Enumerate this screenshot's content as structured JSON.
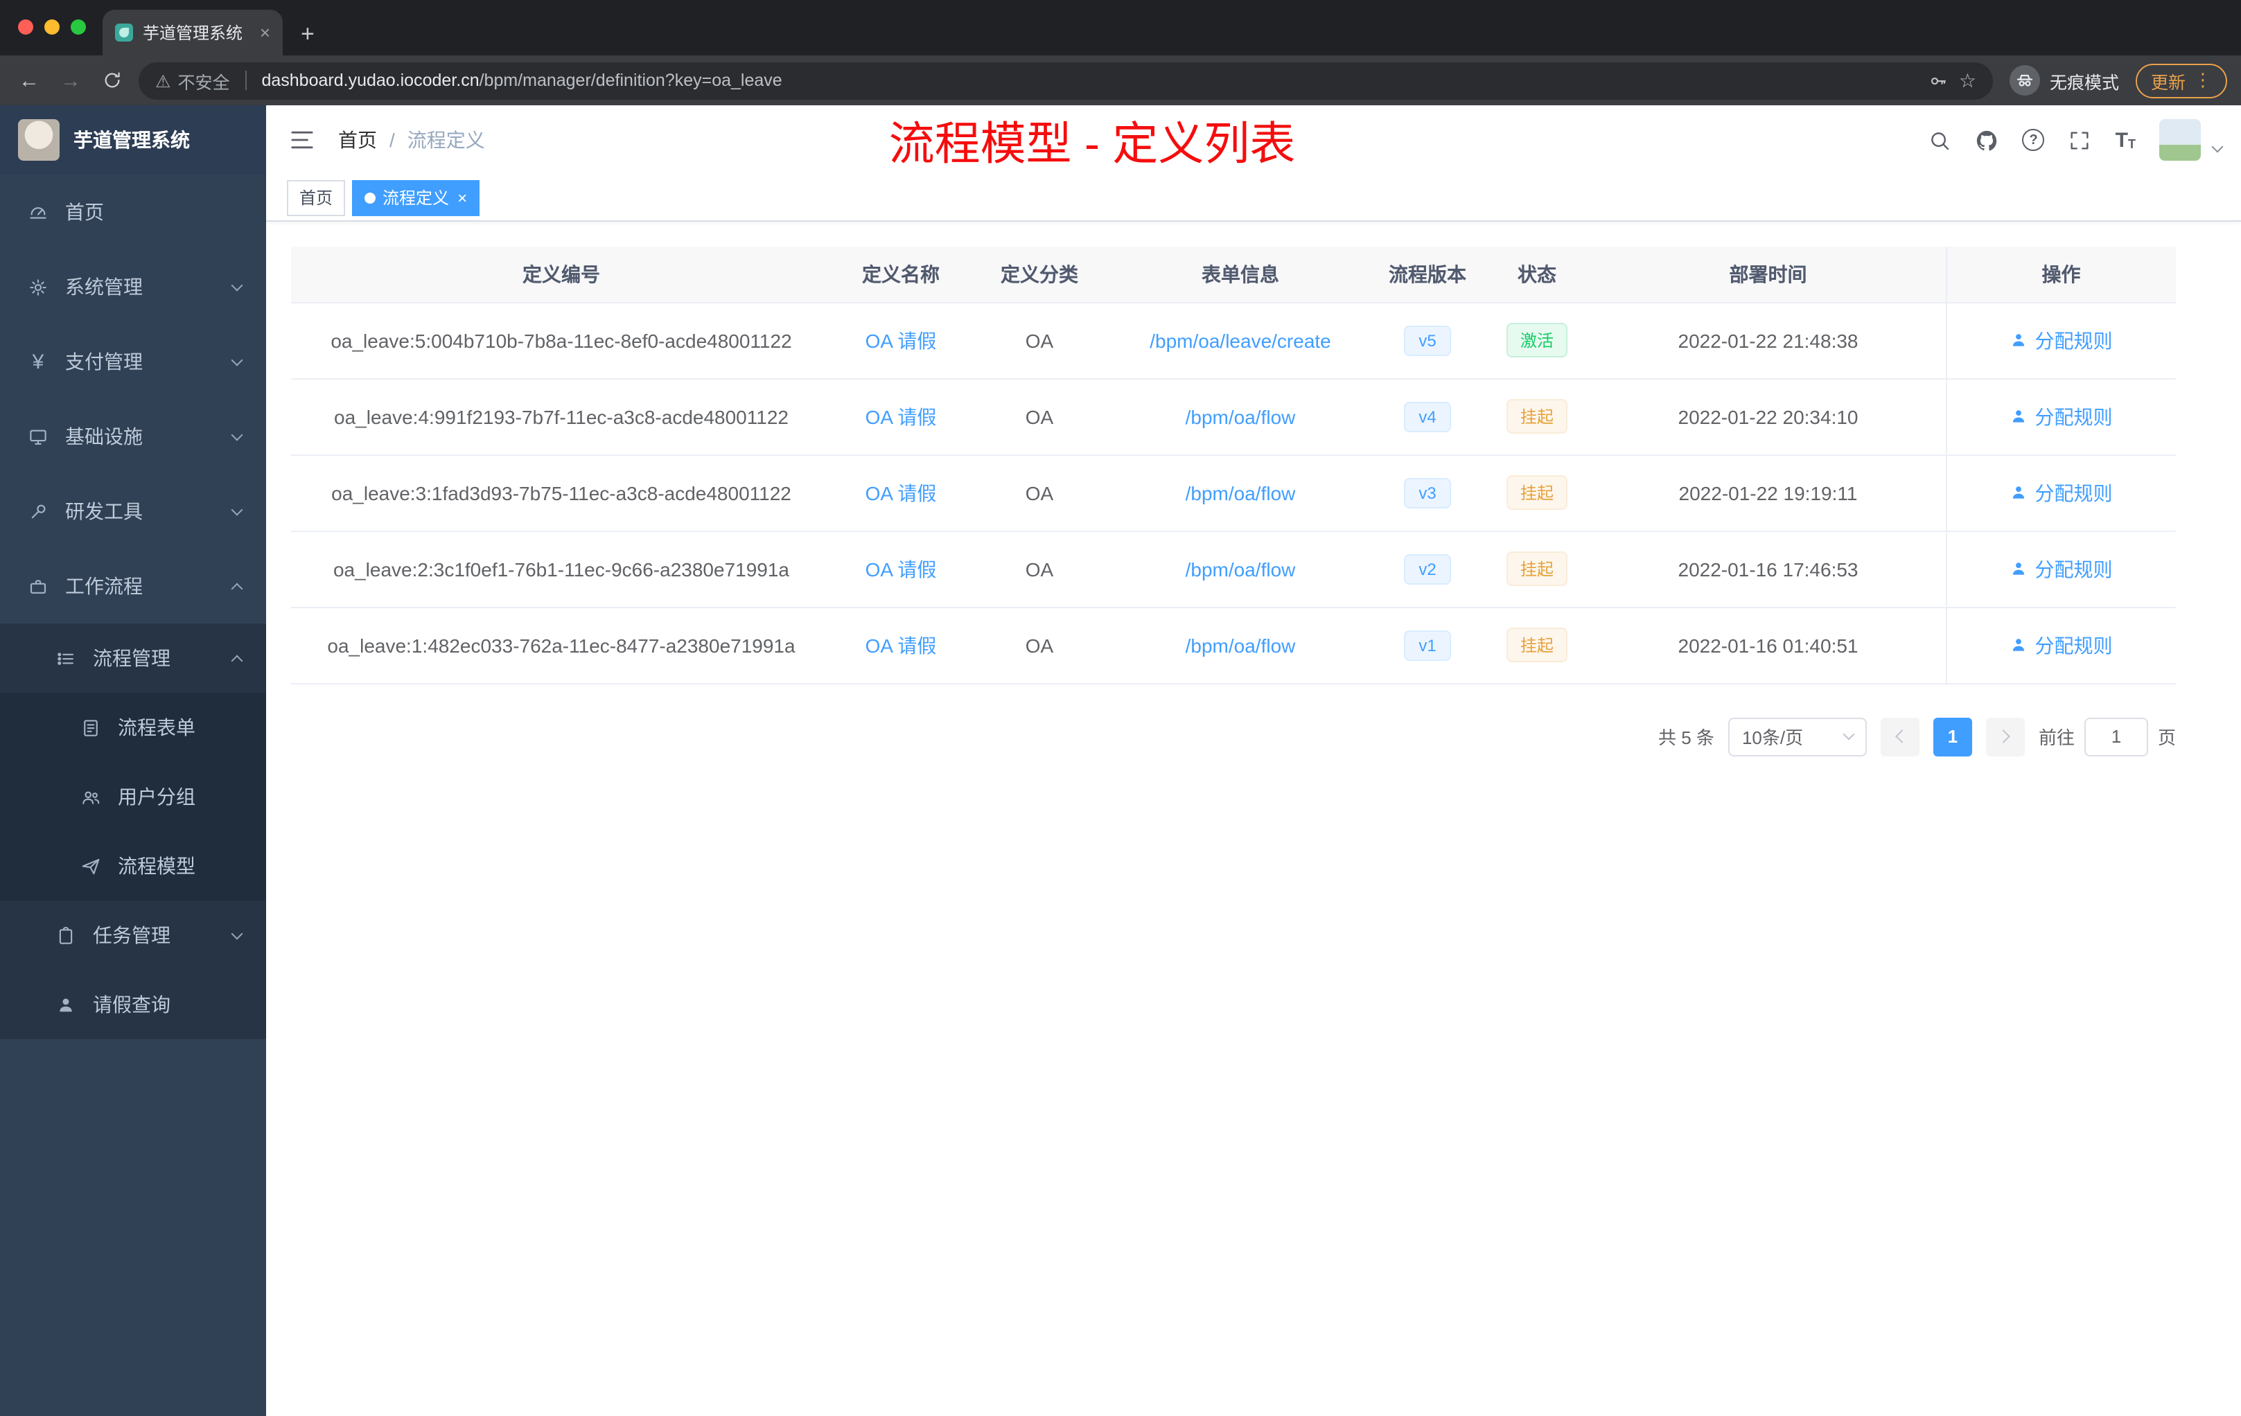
{
  "glyphs": {
    "plus": "+",
    "close": "×",
    "back": "←",
    "forward": "→",
    "star": "☆",
    "warning": "⚠",
    "dots": "⋮",
    "question": "?",
    "yen": "¥",
    "slash": "/",
    "font_large": "T",
    "font_small": "T"
  },
  "browser": {
    "tab_title": "芋道管理系统",
    "security_label": "不安全",
    "url_domain": "dashboard.yudao.iocoder.cn",
    "url_path": "/bpm/manager/definition?key=oa_leave",
    "incognito_label": "无痕模式",
    "update_label": "更新"
  },
  "sidebar": {
    "logo_title": "芋道管理系统",
    "menu": [
      {
        "label": "首页",
        "icon": "dashboard-icon"
      },
      {
        "label": "系统管理",
        "icon": "gear-icon"
      },
      {
        "label": "支付管理",
        "icon": "yen-icon"
      },
      {
        "label": "基础设施",
        "icon": "infrastructure-icon"
      },
      {
        "label": "研发工具",
        "icon": "tools-icon"
      },
      {
        "label": "工作流程",
        "icon": "workflow-icon",
        "expanded": true,
        "children": [
          {
            "label": "流程管理",
            "icon": "process-icon",
            "expanded": true,
            "children": [
              {
                "label": "流程表单",
                "icon": "form-icon"
              },
              {
                "label": "用户分组",
                "icon": "user-group-icon"
              },
              {
                "label": "流程模型",
                "icon": "model-icon"
              }
            ]
          },
          {
            "label": "任务管理",
            "icon": "task-icon"
          },
          {
            "label": "请假查询",
            "icon": "leave-icon"
          }
        ]
      }
    ]
  },
  "header": {
    "breadcrumb": [
      {
        "label": "首页"
      },
      {
        "label": "流程定义"
      }
    ],
    "annotation": "流程模型 - 定义列表"
  },
  "tags": [
    {
      "label": "首页",
      "active": false
    },
    {
      "label": "流程定义",
      "active": true
    }
  ],
  "table": {
    "columns": [
      {
        "label": "定义编号"
      },
      {
        "label": "定义名称"
      },
      {
        "label": "定义分类"
      },
      {
        "label": "表单信息"
      },
      {
        "label": "流程版本"
      },
      {
        "label": "状态"
      },
      {
        "label": "部署时间"
      },
      {
        "label": "操作"
      }
    ],
    "rows": [
      {
        "id": "oa_leave:5:004b710b-7b8a-11ec-8ef0-acde48001122",
        "name": "OA 请假",
        "category": "OA",
        "form": "/bpm/oa/leave/create",
        "version": "v5",
        "status": "激活",
        "deploy_time": "2022-01-22 21:48:38",
        "action": "分配规则"
      },
      {
        "id": "oa_leave:4:991f2193-7b7f-11ec-a3c8-acde48001122",
        "name": "OA 请假",
        "category": "OA",
        "form": "/bpm/oa/flow",
        "version": "v4",
        "status": "挂起",
        "deploy_time": "2022-01-22 20:34:10",
        "action": "分配规则"
      },
      {
        "id": "oa_leave:3:1fad3d93-7b75-11ec-a3c8-acde48001122",
        "name": "OA 请假",
        "category": "OA",
        "form": "/bpm/oa/flow",
        "version": "v3",
        "status": "挂起",
        "deploy_time": "2022-01-22 19:19:11",
        "action": "分配规则"
      },
      {
        "id": "oa_leave:2:3c1f0ef1-76b1-11ec-9c66-a2380e71991a",
        "name": "OA 请假",
        "category": "OA",
        "form": "/bpm/oa/flow",
        "version": "v2",
        "status": "挂起",
        "deploy_time": "2022-01-16 17:46:53",
        "action": "分配规则"
      },
      {
        "id": "oa_leave:1:482ec033-762a-11ec-8477-a2380e71991a",
        "name": "OA 请假",
        "category": "OA",
        "form": "/bpm/oa/flow",
        "version": "v1",
        "status": "挂起",
        "deploy_time": "2022-01-16 01:40:51",
        "action": "分配规则"
      }
    ]
  },
  "pagination": {
    "total": "共 5 条",
    "page_size": "10条/页",
    "current_page": "1",
    "goto_label": "前往",
    "goto_value": "1",
    "page_unit": "页"
  },
  "colors": {
    "accent": "#409eff",
    "success": "#13ce66",
    "warning": "#e6a23c",
    "annotation": "#f50d0d",
    "sidebar_bg": "#304156"
  }
}
